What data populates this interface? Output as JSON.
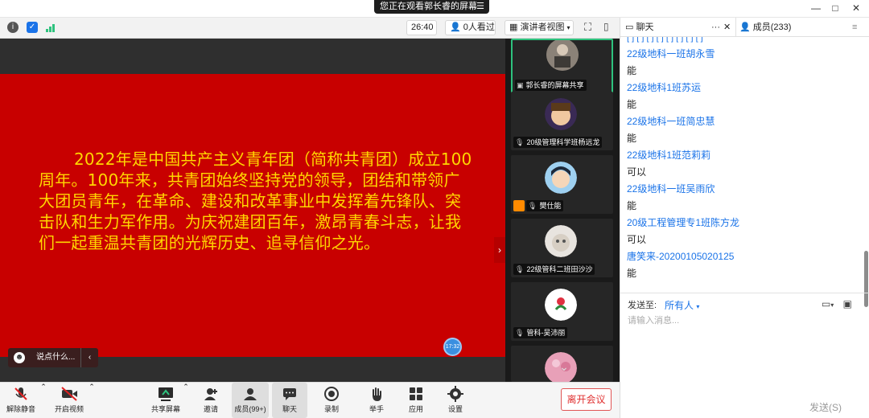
{
  "window": {
    "share_banner": "您正在观看郭长睿的屏幕",
    "minimize": "—",
    "maximize": "□",
    "close": "✕"
  },
  "toolbar": {
    "timer": "26:40",
    "viewers": "0人看过",
    "view_mode": "演讲者视图"
  },
  "slide": {
    "text": "2022年是中国共产主义青年团（简称共青团）成立100周年。100年来，共青团始终坚持党的领导，团结和带领广大团员青年，在革命、建设和改革事业中发挥着先锋队、突击队和生力军作用。为庆祝建团百年，激昂青春斗志，让我们一起重温共青团的光辉历史、追寻信仰之光。",
    "comment_placeholder": "说点什么...",
    "timer_dot": "17:32"
  },
  "video_tiles": [
    {
      "name": "郭长睿的屏幕共享"
    },
    {
      "name": "20级管理科学班杨远龙"
    },
    {
      "name": "樊仕能"
    },
    {
      "name": "22级管科二班田沙沙"
    },
    {
      "name": "管科-吴沛丽"
    },
    {
      "name": ""
    }
  ],
  "bottom_bar": {
    "unmute": "解除静音",
    "start_video": "开启视频",
    "share_screen": "共享屏幕",
    "invite": "邀请",
    "members": "成员(99+)",
    "chat": "聊天",
    "record": "录制",
    "raise_hand": "举手",
    "apps": "应用",
    "settings": "设置",
    "leave": "离开会议"
  },
  "right_panel": {
    "chat_tab": "聊天",
    "members_tab": "成员(233)",
    "more": "···",
    "messages": [
      {
        "name": "22级地科一班胡永雪",
        "text": "能"
      },
      {
        "name": "22级地科1班苏运",
        "text": "能"
      },
      {
        "name": "22级地科一班简忠慧",
        "text": "能"
      },
      {
        "name": "22级地科1班范莉莉",
        "text": "可以"
      },
      {
        "name": "22级地科一班吴雨欣",
        "text": "能"
      },
      {
        "name": "20级工程管理专1班陈方龙",
        "text": "可以"
      },
      {
        "name": "唐笑来-20200105020125",
        "text": "能"
      }
    ],
    "send_to_label": "发送至:",
    "send_to_value": "所有人",
    "input_placeholder": "请输入消息...",
    "send_button": "发送(S)"
  },
  "colors": {
    "slide_bg": "#c80000",
    "slide_text": "#ffd700",
    "chat_name": "#1a73e8",
    "leave": "#e03030",
    "active_tile": "#2ec27e"
  }
}
